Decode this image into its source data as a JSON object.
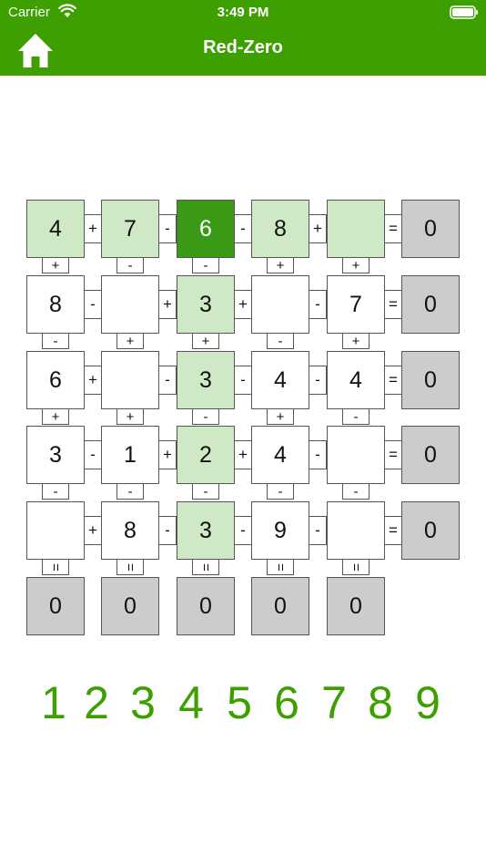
{
  "status_bar": {
    "carrier": "Carrier",
    "time": "3:49 PM"
  },
  "nav": {
    "title": "Red-Zero",
    "home_icon": "home-icon"
  },
  "colors": {
    "accent": "#3da000",
    "highlight": "#cfe8c6",
    "selected": "#3a9a16",
    "result": "#cccccc"
  },
  "puzzle": {
    "rows": [
      {
        "cells": [
          "4",
          "7",
          "6",
          "8",
          ""
        ],
        "ops": [
          "+",
          "-",
          "-",
          "+"
        ],
        "eq": "=",
        "result": "0",
        "styles": [
          "light",
          "light",
          "dark",
          "light",
          "light"
        ]
      },
      {
        "cells": [
          "8",
          "",
          "3",
          "",
          "7"
        ],
        "ops": [
          "-",
          "+",
          "+",
          "-"
        ],
        "eq": "=",
        "result": "0",
        "styles": [
          "",
          "",
          "light",
          "",
          ""
        ]
      },
      {
        "cells": [
          "6",
          "",
          "3",
          "4",
          "4"
        ],
        "ops": [
          "+",
          "-",
          "-",
          "-"
        ],
        "eq": "=",
        "result": "0",
        "styles": [
          "",
          "",
          "light",
          "",
          ""
        ]
      },
      {
        "cells": [
          "3",
          "1",
          "2",
          "4",
          ""
        ],
        "ops": [
          "-",
          "+",
          "+",
          "-"
        ],
        "eq": "=",
        "result": "0",
        "styles": [
          "",
          "",
          "light",
          "",
          ""
        ]
      },
      {
        "cells": [
          "",
          "8",
          "3",
          "9",
          ""
        ],
        "ops": [
          "+",
          "-",
          "-",
          "-"
        ],
        "eq": "=",
        "result": "0",
        "styles": [
          "",
          "",
          "light",
          "",
          ""
        ]
      }
    ],
    "vertical_ops": [
      [
        "+",
        "-",
        "-",
        "+",
        "+"
      ],
      [
        "-",
        "+",
        "+",
        "-",
        "+"
      ],
      [
        "+",
        "+",
        "-",
        "+",
        "-"
      ],
      [
        "-",
        "-",
        "-",
        "-",
        "-"
      ]
    ],
    "column_eq": "=",
    "column_results": [
      "0",
      "0",
      "0",
      "0",
      "0"
    ]
  },
  "number_pad": [
    "1",
    "2",
    "3",
    "4",
    "5",
    "6",
    "7",
    "8",
    "9"
  ]
}
